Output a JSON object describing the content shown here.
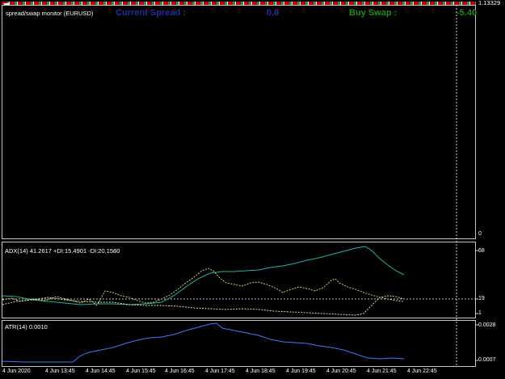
{
  "main_pane": {
    "indicator_title": "spread/swap monitor (EURUSD)",
    "current_spread_label": "Current Spread :",
    "current_spread_value": "0.8",
    "buy_swap_label": "Buy Swap :",
    "buy_swap_value": "-5.40",
    "price_axis_top": "1.13329",
    "price_axis_bottom": "0"
  },
  "adx_pane": {
    "title": "ADX(14) 41.2617 +DI:15.4901 -DI:20.1580",
    "axis_labels": [
      "68",
      "19",
      "1"
    ]
  },
  "atr_pane": {
    "title": "ATR(14) 0.0010",
    "axis_labels": [
      "0.0028",
      "0.0007"
    ]
  },
  "time_axis": [
    "4 Jun 2020",
    "4 Jun 13:45",
    "4 Jun 14:45",
    "4 Jun 15:45",
    "4 Jun 16:45",
    "4 Jun 17:45",
    "4 Jun 18:45",
    "4 Jun 19:45",
    "4 Jun 20:45",
    "4 Jun 21:45",
    "4 Jun 22:45"
  ],
  "colors": {
    "spread_label": "#1f2fa0",
    "swap_label": "#1c8c1c",
    "adx_line": "#20b2aa",
    "di_lines": "#e6e67a",
    "atr_line": "#3a7bff"
  }
}
